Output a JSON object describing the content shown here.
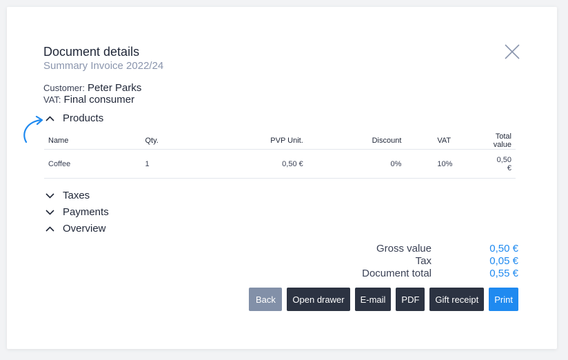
{
  "modal": {
    "title": "Document details",
    "subtitle": "Summary Invoice 2022/24",
    "customer_label": "Customer:",
    "customer_value": "Peter Parks",
    "vat_label": "VAT:",
    "vat_value": "Final consumer"
  },
  "sections": {
    "products": "Products",
    "taxes": "Taxes",
    "payments": "Payments",
    "overview": "Overview"
  },
  "products_table": {
    "headers": [
      "Name",
      "Qty.",
      "PVP Unit.",
      "Discount",
      "VAT",
      "Total value"
    ],
    "rows": [
      [
        "Coffee",
        "1",
        "0,50 €",
        "0%",
        "10%",
        "0,50 €"
      ]
    ]
  },
  "overview": {
    "gross_label": "Gross value",
    "gross_value": "0,50 €",
    "tax_label": "Tax",
    "tax_value": "0,05 €",
    "total_label": "Document total",
    "total_value": "0,55 €"
  },
  "actions": {
    "back": "Back",
    "open_drawer": "Open drawer",
    "email": "E-mail",
    "pdf": "PDF",
    "gift_receipt": "Gift receipt",
    "print": "Print"
  },
  "icons": {
    "close": "close-icon",
    "chevron_up": "chevron-up-icon",
    "chevron_down": "chevron-down-icon",
    "hint_arrow": "curved-arrow-icon"
  },
  "colors": {
    "accent": "#1f8af0",
    "dark_button": "#2c3342",
    "muted_button": "#8290a8",
    "subtitle": "#8a95ad"
  }
}
